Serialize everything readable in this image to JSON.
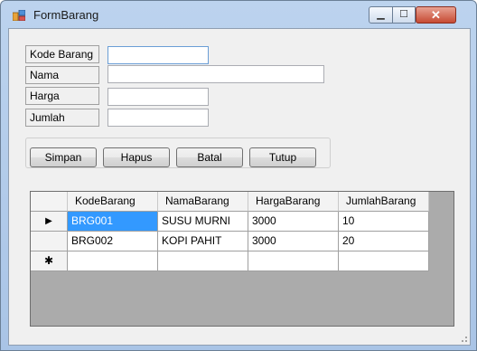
{
  "window": {
    "title": "FormBarang",
    "minimize_glyph": "▁",
    "maximize_glyph": "☐",
    "close_glyph": "✕"
  },
  "form": {
    "fields": [
      {
        "label": "Kode Barang",
        "value": ""
      },
      {
        "label": "Nama",
        "value": ""
      },
      {
        "label": "Harga",
        "value": ""
      },
      {
        "label": "Jumlah",
        "value": ""
      }
    ]
  },
  "buttons": {
    "simpan": "Simpan",
    "hapus": "Hapus",
    "batal": "Batal",
    "tutup": "Tutup"
  },
  "grid": {
    "columns": [
      "KodeBarang",
      "NamaBarang",
      "HargaBarang",
      "JumlahBarang"
    ],
    "rows": [
      {
        "indicator": "▶",
        "cells": [
          "BRG001",
          "SUSU MURNI",
          "3000",
          "10"
        ]
      },
      {
        "indicator": "",
        "cells": [
          "BRG002",
          "KOPI PAHIT",
          "3000",
          "20"
        ]
      }
    ],
    "new_row_indicator": "✱",
    "selection_color": "#3399ff"
  }
}
